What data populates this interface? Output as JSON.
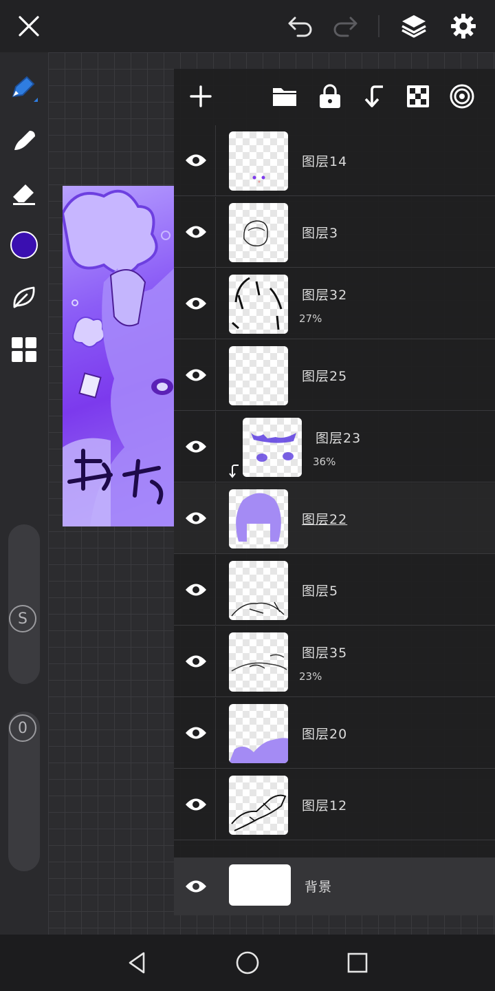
{
  "topbar": {
    "close_icon": "close-icon",
    "undo_icon": "undo-icon",
    "redo_icon": "redo-icon",
    "layers_icon": "layers-icon",
    "settings_icon": "gear-icon"
  },
  "tools": {
    "brush": "pen-icon",
    "smudge": "smudge-icon",
    "eraser": "eraser-icon",
    "color": "#3a0fb0",
    "leaf": "leaf-icon",
    "grid": "grid-icon",
    "size_knob": "S",
    "opacity_knob": "0"
  },
  "layer_toolbar": [
    "add-layer-icon",
    "folder-icon",
    "lock-icon",
    "merge-down-icon",
    "transparency-icon",
    "blend-icon"
  ],
  "layers": [
    {
      "name": "图层14",
      "opacity": "",
      "selected": false
    },
    {
      "name": "图层3",
      "opacity": "",
      "selected": false
    },
    {
      "name": "图层32",
      "opacity": "27%",
      "selected": false
    },
    {
      "name": "图层25",
      "opacity": "",
      "selected": false
    },
    {
      "name": "图层23",
      "opacity": "36%",
      "selected": false,
      "clipped": true
    },
    {
      "name": "图层22",
      "opacity": "",
      "selected": true
    },
    {
      "name": "图层5",
      "opacity": "",
      "selected": false
    },
    {
      "name": "图层35",
      "opacity": "23%",
      "selected": false
    },
    {
      "name": "图层20",
      "opacity": "",
      "selected": false
    },
    {
      "name": "图层12",
      "opacity": "",
      "selected": false
    }
  ],
  "background_layer": {
    "name": "背景"
  },
  "colors": {
    "accent": "#2f7de0",
    "purple": "#8b5cf6"
  }
}
